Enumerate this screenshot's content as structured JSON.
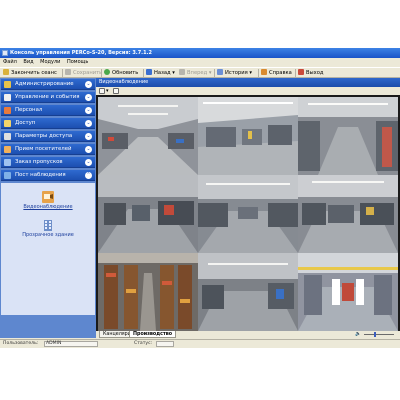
{
  "window": {
    "title": "Консоль управления PERCo-S-20, Версия: 3.7.1.2"
  },
  "menu": [
    {
      "label": "Файл"
    },
    {
      "label": "Вид"
    },
    {
      "label": "Модули"
    },
    {
      "label": "Помощь"
    }
  ],
  "toolbar": {
    "end_session": "Закончить сеанс",
    "save": "Сохранить",
    "refresh": "Обновить",
    "back": "Назад",
    "forward": "Вперед",
    "history": "История",
    "help": "Справка",
    "exit": "Выход"
  },
  "sidebar": {
    "items": [
      {
        "label": "Администрирование",
        "icon": "admin-icon",
        "color": "#e8c34a"
      },
      {
        "label": "Управление и события",
        "icon": "events-icon",
        "color": "#f0f0f0"
      },
      {
        "label": "Персонал",
        "icon": "staff-icon",
        "color": "#e87a3c"
      },
      {
        "label": "Доступ",
        "icon": "access-icon",
        "color": "#f3d46a"
      },
      {
        "label": "Параметры доступа",
        "icon": "access-params-icon",
        "color": "#dfdfdf"
      },
      {
        "label": "Прием посетителей",
        "icon": "visitors-icon",
        "color": "#f2b15b"
      },
      {
        "label": "Заказ пропусков",
        "icon": "passes-icon",
        "color": "#9fc2f0"
      },
      {
        "label": "Пост наблюдения",
        "icon": "monitoring-icon",
        "color": "#7fb1e8"
      }
    ],
    "panel": [
      {
        "label": "Видеонаблюдение",
        "icon": "video-surveillance-icon"
      },
      {
        "label": "Прозрачное здание",
        "icon": "transparent-building-icon"
      }
    ]
  },
  "main": {
    "header": "Видеонаблюдение",
    "tabs": [
      {
        "label": "Канцелярия"
      },
      {
        "label": "Производство"
      }
    ]
  },
  "statusbar": {
    "user_label": "Пользователь:",
    "user_value": "ADMIN",
    "status_label": "Статус:"
  },
  "colors": {
    "accent": "#2f6ad0",
    "sidebar_bg": "#5e87cf",
    "panel_bg": "#dae3f6"
  }
}
